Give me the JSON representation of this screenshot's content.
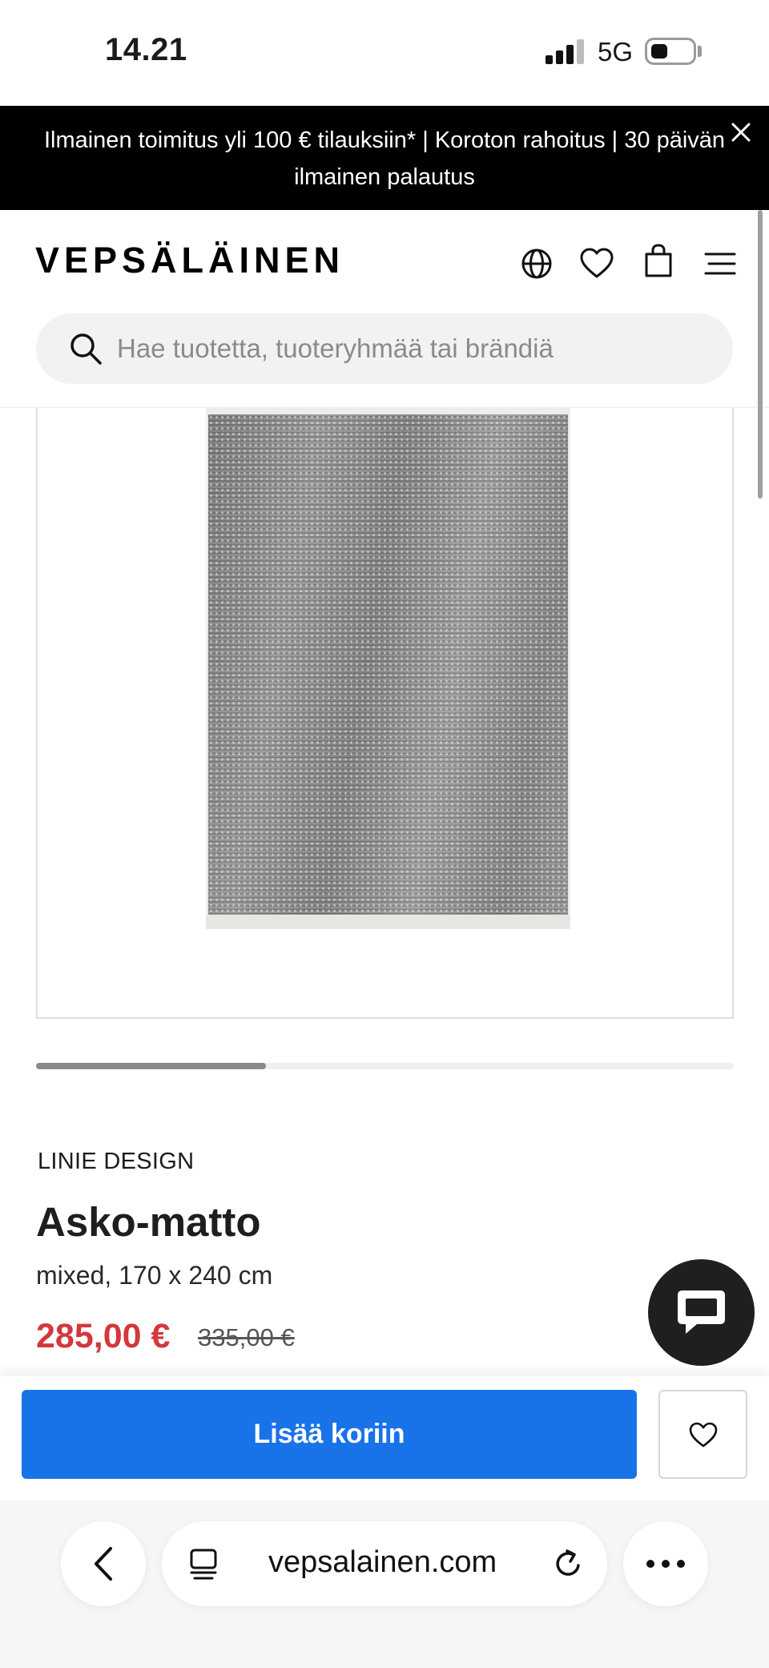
{
  "status_bar": {
    "time": "14.21",
    "network": "5G"
  },
  "promo": {
    "text": "Ilmainen toimitus yli 100 € tilauksiin* | Koroton rahoitus | 30 päivän ilmainen palautus"
  },
  "header": {
    "logo": "VEPSÄLÄINEN",
    "icons": [
      "globe-icon",
      "heart-icon",
      "shopping-bag-icon",
      "menu-icon"
    ]
  },
  "search": {
    "placeholder": "Hae tuotetta, tuoteryhmää tai brändiä"
  },
  "gallery": {
    "progress": 0.33
  },
  "product": {
    "brand": "LINIE DESIGN",
    "name": "Asko-matto",
    "variant": "mixed, 170 x 240 cm",
    "price": "285,00 €",
    "original_price": "335,00 €"
  },
  "actions": {
    "add_to_cart": "Lisää koriin"
  },
  "browser": {
    "url": "vepsalainen.com"
  },
  "colors": {
    "sale": "#d2383e",
    "primary_button": "#1973e8",
    "banner": "#000000"
  }
}
